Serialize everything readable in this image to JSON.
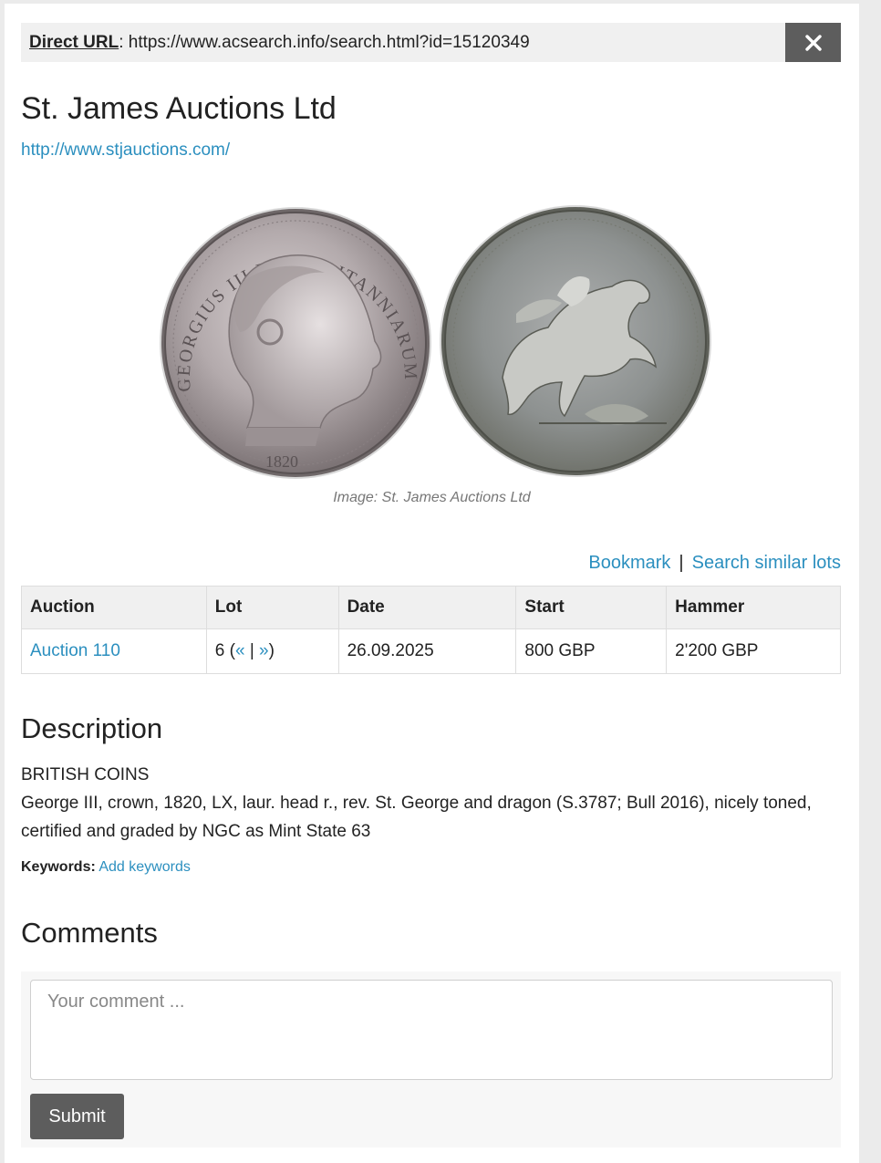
{
  "direct_url": {
    "label": "Direct URL",
    "value": "https://www.acsearch.info/search.html?id=15120349"
  },
  "close": {
    "icon": "close-icon"
  },
  "auction_house": {
    "name": "St. James Auctions Ltd",
    "website": "http://www.stjauctions.com/"
  },
  "image": {
    "obverse_legend_top": "GEORGIUS III D:G: BRITANNIARUM REX",
    "obverse_date": "1820",
    "caption": "Image: St. James Auctions Ltd"
  },
  "actions": {
    "bookmark": "Bookmark",
    "separator": "|",
    "search_similar": "Search similar lots"
  },
  "lot_table": {
    "headers": [
      "Auction",
      "Lot",
      "Date",
      "Start",
      "Hammer"
    ],
    "row": {
      "auction": "Auction 110",
      "lot_number": "6",
      "lot_prev": "«",
      "lot_sep": "|",
      "lot_next": "»",
      "date": "26.09.2025",
      "start": "800 GBP",
      "hammer": "2'200 GBP"
    }
  },
  "description": {
    "heading": "Description",
    "line1": "BRITISH COINS",
    "line2": "George III, crown, 1820, LX, laur. head r., rev. St. George and dragon (S.3787; Bull 2016), nicely toned, certified and graded by NGC as Mint State 63",
    "keywords_label": "Keywords:",
    "keywords_link": "Add keywords"
  },
  "comments": {
    "heading": "Comments",
    "placeholder": "Your comment ...",
    "submit_label": "Submit"
  },
  "colors": {
    "link": "#2b8fbf",
    "button_dark": "#5d5d5d",
    "header_bg": "#f0f0f0"
  }
}
